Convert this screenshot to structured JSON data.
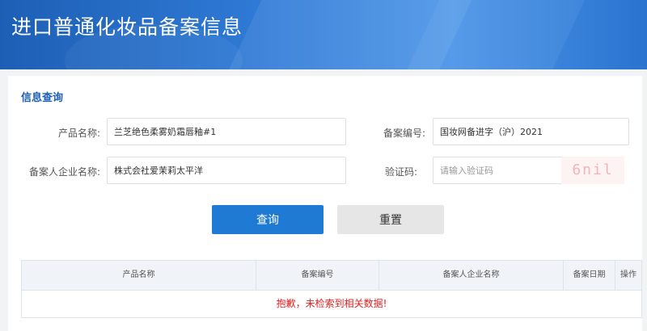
{
  "header": {
    "title": "进口普通化妆品备案信息"
  },
  "section": {
    "title": "信息查询"
  },
  "form": {
    "product_name_label": "产品名称:",
    "product_name_value": "兰芝绝色柔雾奶霜唇釉#1",
    "record_no_label": "备案编号:",
    "record_no_value": "国妆网备进字（沪）2021",
    "company_label": "备案人企业名称:",
    "company_value": "株式会社爱茉莉太平洋",
    "captcha_label": "验证码:",
    "captcha_placeholder": "请输入验证码",
    "captcha_image_text": "6nil"
  },
  "buttons": {
    "query": "查询",
    "reset": "重置"
  },
  "table": {
    "columns": [
      "产品名称",
      "备案编号",
      "备案人企业名称",
      "备案日期",
      "操作"
    ],
    "empty_message": "抱歉，未检索到相关数据!"
  },
  "colors": {
    "brand": "#1f7ad3",
    "header": "#2f7ad6",
    "error": "#e02020"
  }
}
